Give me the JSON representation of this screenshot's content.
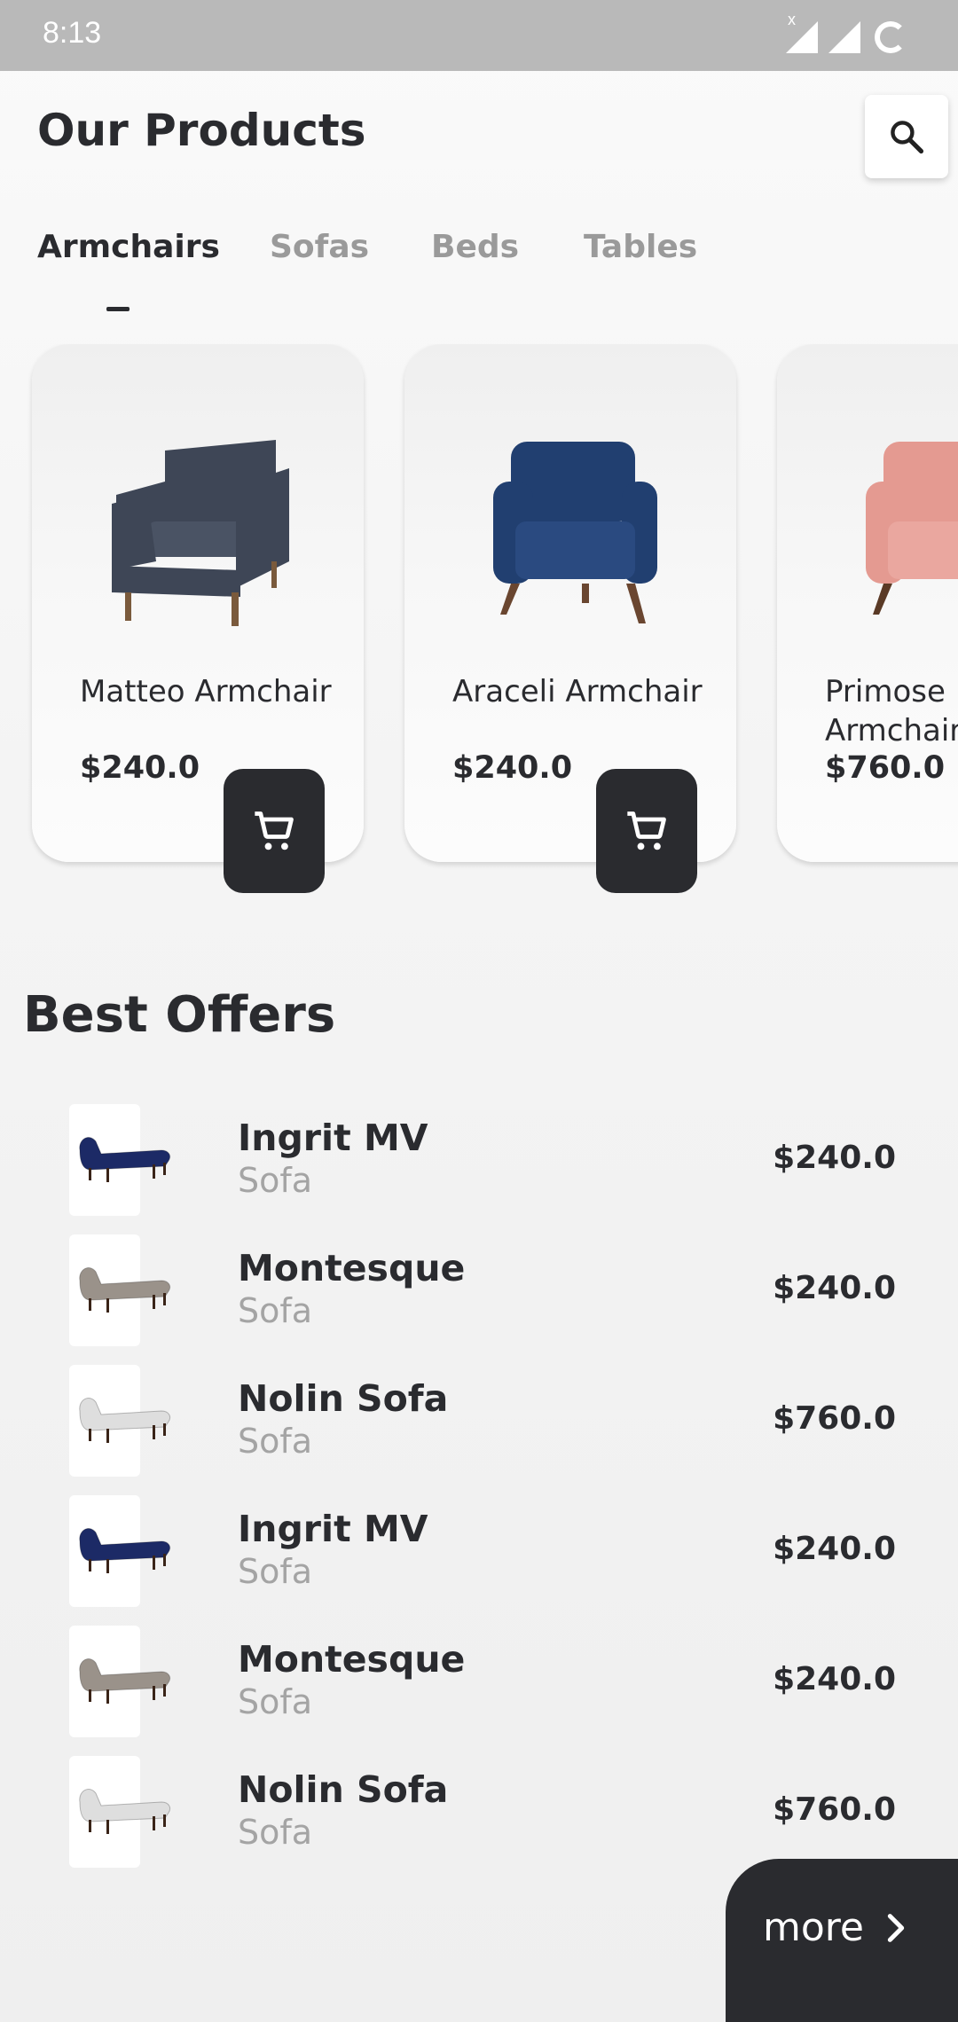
{
  "status_bar": {
    "time": "8:13",
    "signal_label": "x"
  },
  "header": {
    "title": "Our Products"
  },
  "tabs": [
    {
      "label": "Armchairs",
      "active": true
    },
    {
      "label": "Sofas",
      "active": false
    },
    {
      "label": "Beds",
      "active": false
    },
    {
      "label": "Tables",
      "active": false
    }
  ],
  "products": [
    {
      "name": "Matteo Armchair",
      "price": "$240.0",
      "color": "#3e4656"
    },
    {
      "name": "Araceli Armchair",
      "price": "$240.0",
      "color": "#213f70"
    },
    {
      "name": "Primose Armchair",
      "price": "$760.0",
      "color": "#e49a91"
    }
  ],
  "best_offers": {
    "title": "Best Offers",
    "items": [
      {
        "name": "Ingrit MV",
        "type": "Sofa",
        "price": "$240.0",
        "color": "#1c2a66"
      },
      {
        "name": "Montesque",
        "type": "Sofa",
        "price": "$240.0",
        "color": "#9a928a"
      },
      {
        "name": "Nolin Sofa",
        "type": "Sofa",
        "price": "$760.0",
        "color": "#dedede"
      },
      {
        "name": "Ingrit MV",
        "type": "Sofa",
        "price": "$240.0",
        "color": "#1c2a66"
      },
      {
        "name": "Montesque",
        "type": "Sofa",
        "price": "$240.0",
        "color": "#9a928a"
      },
      {
        "name": "Nolin Sofa",
        "type": "Sofa",
        "price": "$760.0",
        "color": "#dedede"
      }
    ]
  },
  "more_button": {
    "label": "more"
  },
  "colors": {
    "dark": "#2a2b2f",
    "muted": "#9a9a9a"
  },
  "icons": {
    "search": "search-icon",
    "cart": "cart-icon",
    "more": "chevron-right-icon"
  }
}
